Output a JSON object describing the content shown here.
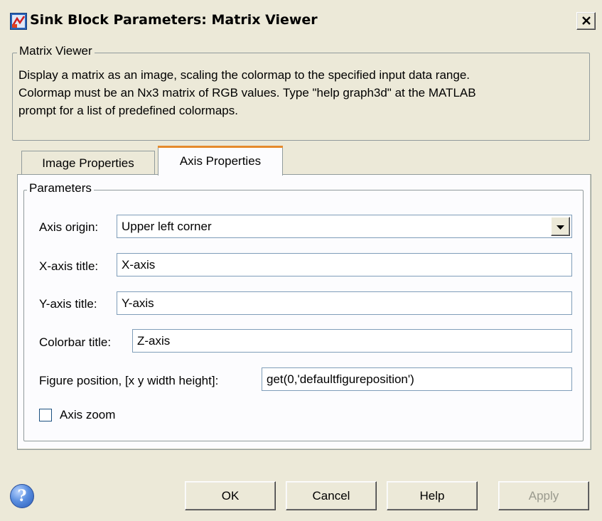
{
  "window": {
    "title": "Sink Block Parameters: Matrix Viewer",
    "close_label": "×",
    "icon": "simulink-block-icon"
  },
  "description_group": {
    "label": "Matrix Viewer",
    "text": "Display a matrix as an image, scaling the colormap to the specified input data range.\nColormap must be an Nx3 matrix of RGB values.  Type \"help graph3d\" at the MATLAB\nprompt for a list of predefined colormaps."
  },
  "tabs": [
    {
      "label": "Image Properties",
      "active": false
    },
    {
      "label": "Axis Properties",
      "active": true
    }
  ],
  "parameters": {
    "label": "Parameters",
    "axis_origin": {
      "label": "Axis origin:",
      "value": "Upper left corner"
    },
    "x_axis_title": {
      "label": "X-axis title:",
      "value": "X-axis"
    },
    "y_axis_title": {
      "label": "Y-axis title:",
      "value": "Y-axis"
    },
    "colorbar_title": {
      "label": "Colorbar title:",
      "value": "Z-axis"
    },
    "figure_position": {
      "label": "Figure position, [x y width height]:",
      "value": "get(0,'defaultfigureposition')"
    },
    "axis_zoom": {
      "label": "Axis zoom",
      "checked": false
    }
  },
  "buttons": {
    "help_icon": "?",
    "ok": "OK",
    "cancel": "Cancel",
    "help": "Help",
    "apply": "Apply"
  }
}
